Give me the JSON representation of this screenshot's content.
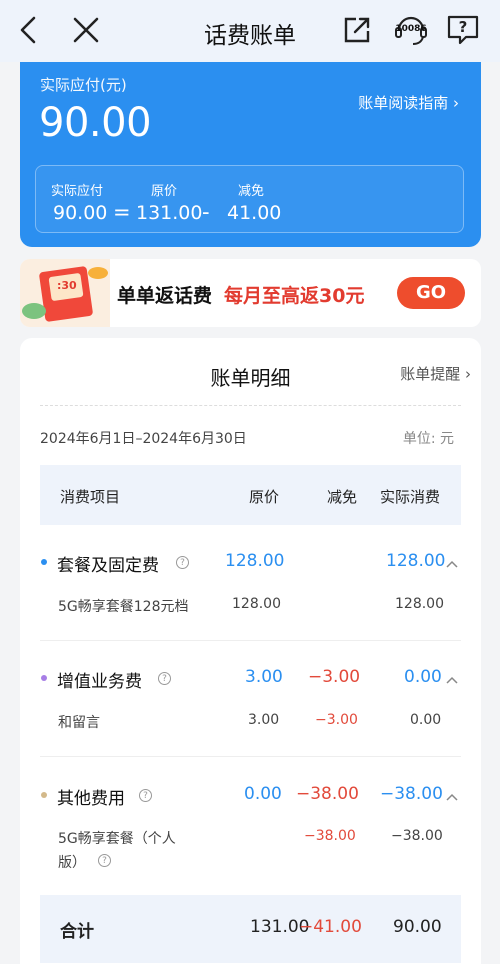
{
  "header": {
    "title": "话费账单",
    "back_icon": "chevron-left-icon",
    "close_icon": "close-icon",
    "share_icon": "share-icon",
    "service_label": "10086",
    "help_label": "?"
  },
  "summary": {
    "label": "实际应付(元)",
    "amount": "90.00",
    "guide_link": "账单阅读指南 ›",
    "breakdown": {
      "actual_label": "实际应付",
      "original_label": "原价",
      "discount_label": "减免",
      "actual_value": "90.00",
      "eq": "=",
      "original_value": "131.00",
      "minus": "-",
      "discount_value": "41.00"
    }
  },
  "promo": {
    "title": "单单返话费",
    "subtitle": "每月至高返30元",
    "button": "GO",
    "image_text": ":30"
  },
  "detail": {
    "title": "账单明细",
    "remind_link": "账单提醒 ›",
    "period": "2024年6月1日–2024年6月30日",
    "unit": "单位: 元",
    "columns": [
      "消费项目",
      "原价",
      "减免",
      "实际消费"
    ],
    "categories": [
      {
        "name": "套餐及固定费",
        "dot_color": "#2b8ff0",
        "original": "128.00",
        "discount": "",
        "actual": "128.00",
        "items": [
          {
            "name": "5G畅享套餐128元档",
            "original": "128.00",
            "discount": "",
            "actual": "128.00"
          }
        ]
      },
      {
        "name": "增值业务费",
        "dot_color": "#a77ee6",
        "original": "3.00",
        "discount": "−3.00",
        "actual": "0.00",
        "items": [
          {
            "name": "和留言",
            "original": "3.00",
            "discount": "−3.00",
            "actual": "0.00"
          }
        ]
      },
      {
        "name": "其他费用",
        "dot_color": "#d3b98a",
        "original": "0.00",
        "discount": "−38.00",
        "actual": "−38.00",
        "items": [
          {
            "name_line1": "5G畅享套餐（个人",
            "name_line2": "版）",
            "original": "",
            "discount": "−38.00",
            "actual": "−38.00"
          }
        ]
      }
    ],
    "total": {
      "label": "合计",
      "original": "131.00",
      "discount": "−41.00",
      "actual": "90.00"
    }
  },
  "colors": {
    "accent": "#2b8ff0",
    "negative": "#e24a3b",
    "promo_button": "#ee4d2d"
  }
}
